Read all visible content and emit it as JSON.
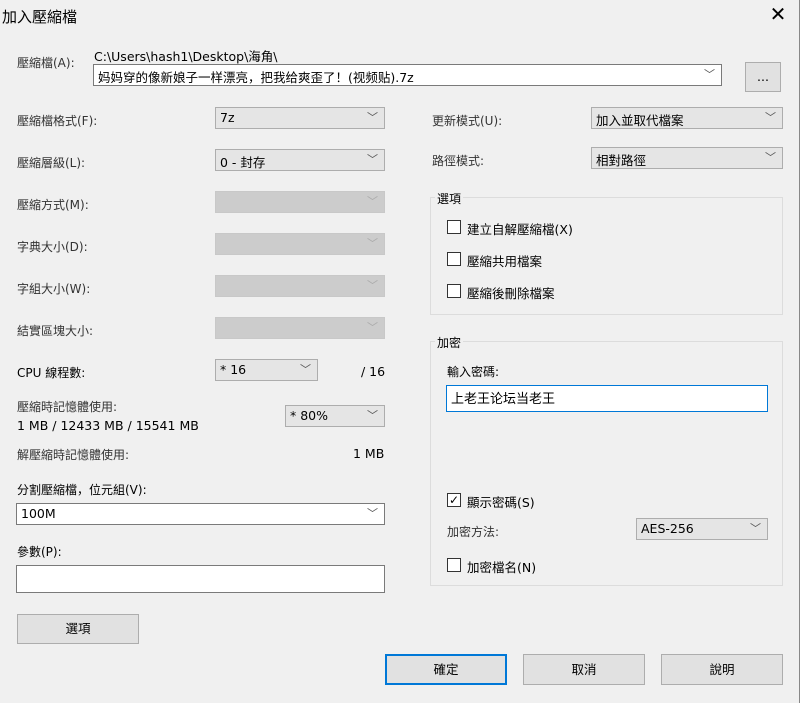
{
  "window": {
    "title": "加入壓縮檔",
    "close_icon": "close-icon"
  },
  "archive": {
    "label": "壓縮檔(A):",
    "path": "C:\\Users\\hash1\\Desktop\\海角\\",
    "filename": "妈妈穿的像新娘子一样漂亮，把我给爽歪了！(视频贴).7z",
    "browse": "..."
  },
  "left": {
    "format": {
      "label": "壓縮檔格式(F):",
      "value": "7z"
    },
    "level": {
      "label": "壓縮層級(L):",
      "value": "0 - 封存"
    },
    "method": {
      "label": "壓縮方式(M):",
      "value": ""
    },
    "dict": {
      "label": "字典大小(D):",
      "value": ""
    },
    "word": {
      "label": "字組大小(W):",
      "value": ""
    },
    "solid": {
      "label": "結實區塊大小:",
      "value": ""
    },
    "cpu": {
      "label": "CPU 線程數:",
      "value": "* 16",
      "max": "/ 16"
    },
    "mem": {
      "label": "壓縮時記憶體使用:",
      "detail": "1 MB / 12433 MB / 15541 MB",
      "value": "* 80%"
    },
    "decomp": {
      "label": "解壓縮時記憶體使用:",
      "value": "1 MB"
    },
    "split": {
      "label": "分割壓縮檔，位元組(V):",
      "value": "100M"
    },
    "params": {
      "label": "參數(P):",
      "value": ""
    },
    "options_button": "選項"
  },
  "right": {
    "update": {
      "label": "更新模式(U):",
      "value": "加入並取代檔案"
    },
    "pathmode": {
      "label": "路徑模式:",
      "value": "相對路徑"
    },
    "options": {
      "title": "選項",
      "items": [
        {
          "label": "建立自解壓縮檔(X)",
          "checked": false
        },
        {
          "label": "壓縮共用檔案",
          "checked": false
        },
        {
          "label": "壓縮後刪除檔案",
          "checked": false
        }
      ]
    },
    "encrypt": {
      "title": "加密",
      "pw_label": "輸入密碼:",
      "password": "上老王论坛当老王",
      "show_pw": {
        "label": "顯示密碼(S)",
        "checked": true
      },
      "method_label": "加密方法:",
      "method": "AES-256",
      "enc_names": {
        "label": "加密檔名(N)",
        "checked": false
      }
    }
  },
  "buttons": {
    "ok": "確定",
    "cancel": "取消",
    "help": "說明"
  }
}
